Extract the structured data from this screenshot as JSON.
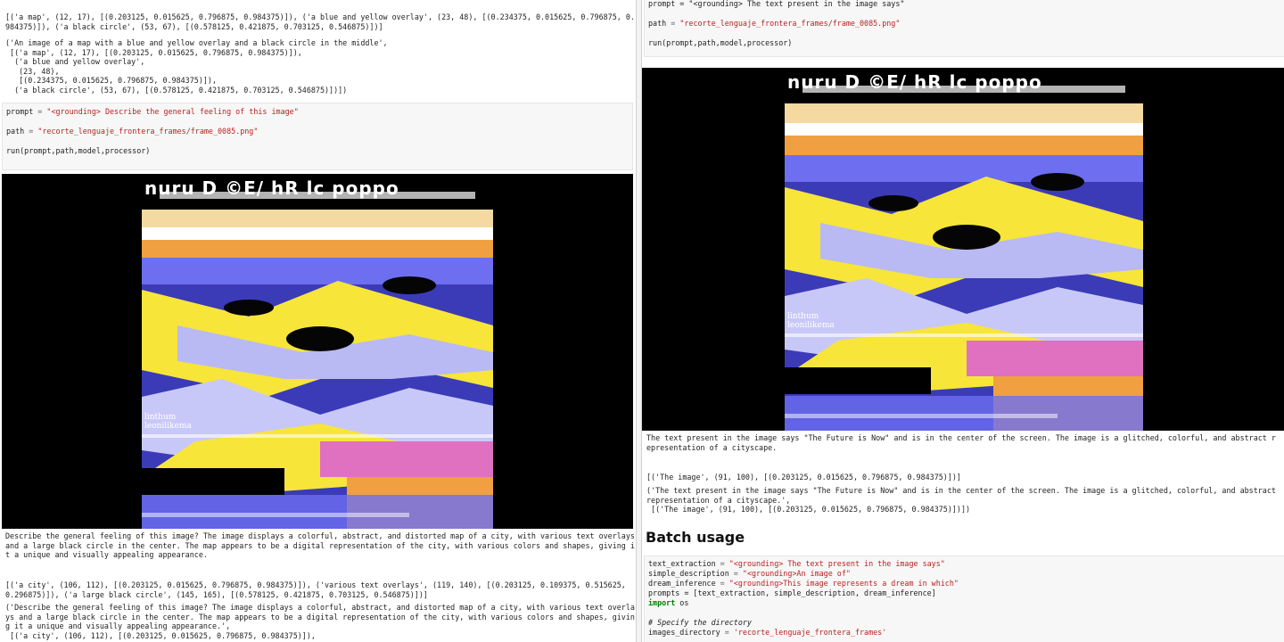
{
  "left": {
    "top_output": [
      "[('a map', (12, 17), [(0.203125, 0.015625, 0.796875, 0.984375)]), ('a blue and yellow overlay', (23, 48), [(0.234375, 0.015625, 0.796875, 0.",
      "984375)]), ('a black circle', (53, 67), [(0.578125, 0.421875, 0.703125, 0.546875)])]"
    ],
    "tuple_output": [
      "('An image of a map with a blue and yellow overlay and a black circle in the middle',",
      " [('a map', (12, 17), [(0.203125, 0.015625, 0.796875, 0.984375)]),",
      "  ('a blue and yellow overlay',",
      "   (23, 48),",
      "   [(0.234375, 0.015625, 0.796875, 0.984375)]),",
      "  ('a black circle', (53, 67), [(0.578125, 0.421875, 0.703125, 0.546875)])])"
    ],
    "cell": {
      "prompt_var": "prompt",
      "prompt_value": "\"<grounding> Describe the general feeling of this image\"",
      "path_var": "path",
      "path_value": "\"recorte_lenguaje_frontera_frames/frame_0085.png\"",
      "run_call": "run(prompt,path,model,processor)"
    },
    "description": [
      "Describe the general feeling of this image? The image displays a colorful, abstract, and distorted map of a city, with various text overlays",
      "and a large black circle in the center. The map appears to be a digital representation of the city, with various colors and shapes, giving i",
      "t a unique and visually appealing appearance."
    ],
    "entities": [
      "[('a city', (106, 112), [(0.203125, 0.015625, 0.796875, 0.984375)]), ('various text overlays', (119, 140), [(0.203125, 0.109375, 0.515625,",
      "0.296875)]), ('a large black circle', (145, 165), [(0.578125, 0.421875, 0.703125, 0.546875)])]"
    ],
    "tuple_bottom": [
      "('Describe the general feeling of this image? The image displays a colorful, abstract, and distorted map of a city, with various text overla",
      "ys and a large black circle in the center. The map appears to be a digital representation of the city, with various colors and shapes, givin",
      "g it a unique and visually appealing appearance.',",
      " [('a city', (106, 112), [(0.203125, 0.015625, 0.796875, 0.984375)]),"
    ]
  },
  "right": {
    "cell_top": {
      "prompt_partial": "prompt = \"<grounding> The text present in the image says\"",
      "path_var": "path",
      "path_value": "\"recorte_lenguaje_frontera_frames/frame_0085.png\"",
      "run_call": "run(prompt,path,model,processor)"
    },
    "description": [
      "The text present in the image says \"The Future is Now\" and is in the center of the screen. The image is a glitched, colorful, and abstract r",
      "epresentation of a cityscape."
    ],
    "entities": [
      "[('The image', (91, 100), [(0.203125, 0.015625, 0.796875, 0.984375)])]"
    ],
    "tuple": [
      "('The text present in the image says \"The Future is Now\" and is in the center of the screen. The image is a glitched, colorful, and abstract",
      "representation of a cityscape.',",
      " [('The image', (91, 100), [(0.203125, 0.015625, 0.796875, 0.984375)])])"
    ],
    "heading": "Batch usage",
    "batch_cell": {
      "text_extraction_var": "text_extraction",
      "text_extraction_value": "\"<grounding> The text present in the image says\"",
      "simple_description_var": "simple_description",
      "simple_description_value": "\"<grounding>An image of\"",
      "dream_inference_var": "dream_inference",
      "dream_inference_value": "\"<grounding>This image represents a dream in which\"",
      "prompts_line": "prompts = [text_extraction, simple_description, dream_inference]",
      "import_kw": "import",
      "import_mod": " os",
      "comment": "# Specify the directory",
      "images_dir_var": "images_directory",
      "images_dir_value": "'recorte_lenguaje_frontera_frames'"
    }
  },
  "frame_image": {
    "header_glyphs": "nuru D ©E/ hR  lc poppo",
    "overlay_text_1": "linthum",
    "overlay_text_2": "leonilikema",
    "colors": {
      "blue": "#6d6ff0",
      "yellow": "#f7e53a",
      "black": "#050505",
      "orange": "#f0a040",
      "pink": "#e070c0",
      "white": "#f4f4f4"
    }
  }
}
